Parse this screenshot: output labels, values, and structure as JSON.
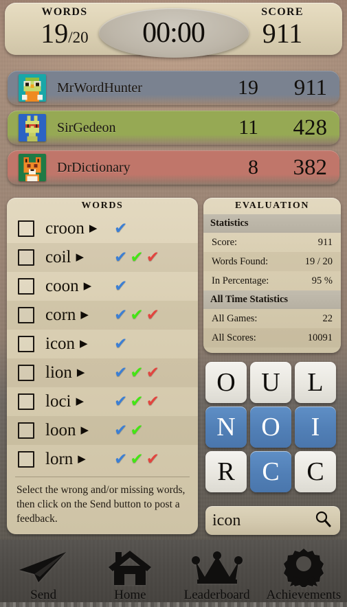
{
  "statusbar": {
    "words_caption": "WORDS",
    "words_found": "19",
    "words_total": "/20",
    "timer": "00:00",
    "score_caption": "SCORE",
    "score_value": "911"
  },
  "leaderboard": {
    "rows": [
      {
        "name": "MrWordHunter",
        "words": "19",
        "score": "911",
        "color": "#7a8290",
        "avatar": "owl-avatar"
      },
      {
        "name": "SirGedeon",
        "words": "11",
        "score": "428",
        "color": "#96a954",
        "avatar": "llama-avatar"
      },
      {
        "name": "DrDictionary",
        "words": "8",
        "score": "382",
        "color": "#c0766a",
        "avatar": "fox-avatar"
      }
    ]
  },
  "words_panel": {
    "title": "WORDS",
    "hint": "Select the wrong and/or missing words, then click on the Send button to post a feedback.",
    "arrow_glyph": "▶",
    "check_glyph": "✔",
    "items": [
      {
        "word": "croon",
        "blue": true,
        "green": false,
        "red": false
      },
      {
        "word": "coil",
        "blue": true,
        "green": true,
        "red": true
      },
      {
        "word": "coon",
        "blue": true,
        "green": false,
        "red": false
      },
      {
        "word": "corn",
        "blue": true,
        "green": true,
        "red": true
      },
      {
        "word": "icon",
        "blue": true,
        "green": false,
        "red": false
      },
      {
        "word": "lion",
        "blue": true,
        "green": true,
        "red": true
      },
      {
        "word": "loci",
        "blue": true,
        "green": true,
        "red": true
      },
      {
        "word": "loon",
        "blue": true,
        "green": true,
        "red": false
      },
      {
        "word": "lorn",
        "blue": true,
        "green": true,
        "red": true
      }
    ]
  },
  "evaluation": {
    "title": "EVALUATION",
    "section_statistics": "Statistics",
    "section_all_time": "All Time Statistics",
    "rows": [
      {
        "label": "Score:",
        "value": "911"
      },
      {
        "label": "Words Found:",
        "value": "19 / 20"
      },
      {
        "label": "In Percentage:",
        "value": "95 %"
      }
    ],
    "all_time_rows": [
      {
        "label": "All Games:",
        "value": "22"
      },
      {
        "label": "All Scores:",
        "value": "10091"
      }
    ]
  },
  "tiles": [
    {
      "letter": "O",
      "state": "white"
    },
    {
      "letter": "U",
      "state": "white"
    },
    {
      "letter": "L",
      "state": "white"
    },
    {
      "letter": "N",
      "state": "blue"
    },
    {
      "letter": "O",
      "state": "blue"
    },
    {
      "letter": "I",
      "state": "blue"
    },
    {
      "letter": "R",
      "state": "white"
    },
    {
      "letter": "C",
      "state": "blue"
    },
    {
      "letter": "C",
      "state": "white"
    }
  ],
  "word_input": {
    "value": "icon",
    "placeholder": "",
    "icon": "search-icon"
  },
  "bottom_nav": {
    "items": [
      {
        "label": "Send",
        "icon": "paper-plane-icon"
      },
      {
        "label": "Home",
        "icon": "house-icon"
      },
      {
        "label": "Leaderboard",
        "icon": "crown-icon"
      },
      {
        "label": "Achievements",
        "icon": "award-rosette-icon"
      }
    ]
  },
  "colors": {
    "tile_selected": "#5180b6",
    "tile_unselected": "#ecebe5",
    "mark_blue": "#3c7fd4",
    "mark_green": "#44e515",
    "mark_red": "#e2453f",
    "panel_bg": "#dacfb3"
  }
}
